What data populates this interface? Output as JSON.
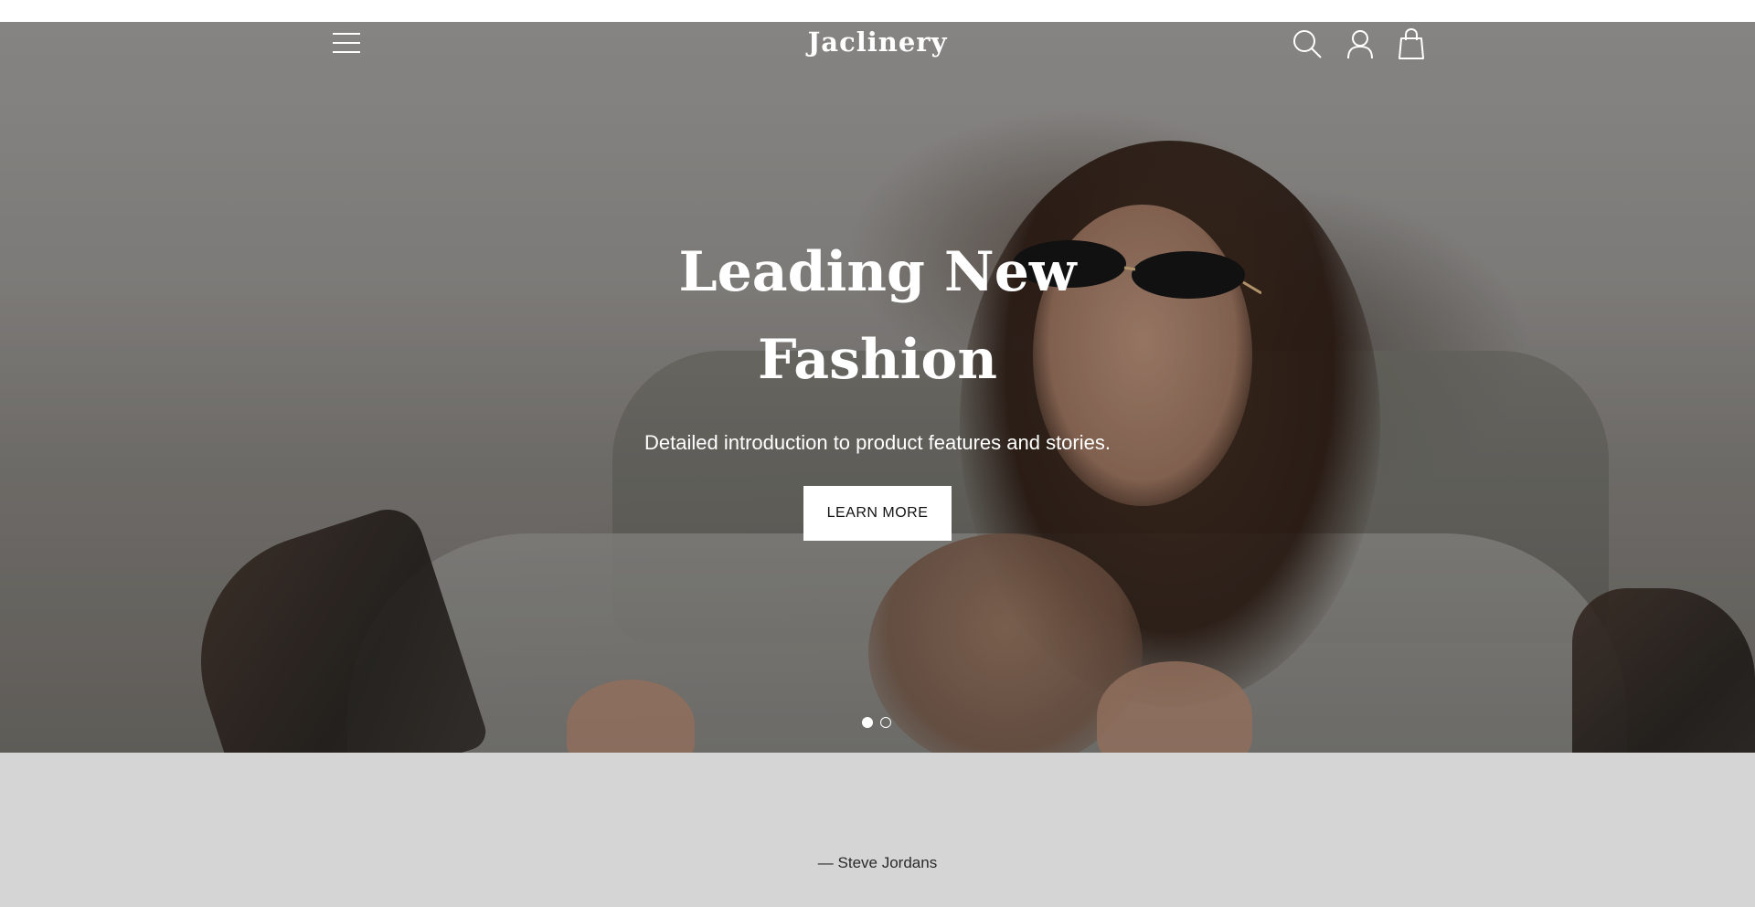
{
  "header": {
    "brand": "Jaclinery",
    "menu_icon": "hamburger-menu-icon",
    "search_icon": "search-icon",
    "account_icon": "user-icon",
    "cart_icon": "shopping-bag-icon"
  },
  "hero": {
    "title_line1": "Leading New",
    "title_line2": "Fashion",
    "subtitle": "Detailed introduction to product features and stories.",
    "cta_label": "LEARN MORE",
    "slide_count": 2,
    "active_slide": 1
  },
  "testimonial": {
    "attribution": "—  Steve Jordans"
  },
  "colors": {
    "hero_text": "#ffffff",
    "testimonial_bg": "#d5d5d5",
    "button_bg": "#ffffff",
    "button_text": "#111111"
  }
}
